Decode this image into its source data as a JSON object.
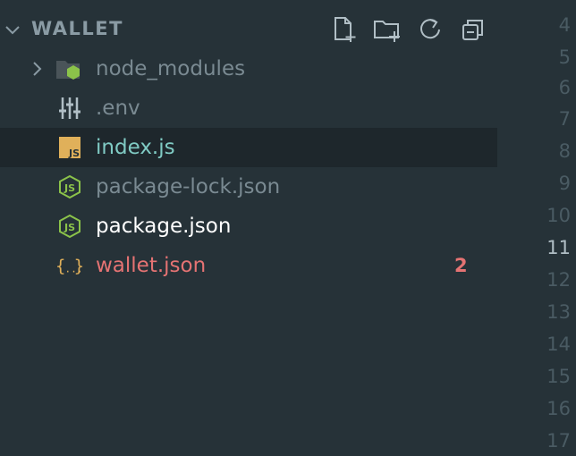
{
  "explorer": {
    "title": "WALLET",
    "actions": [
      {
        "name": "new-file-icon"
      },
      {
        "name": "new-folder-icon"
      },
      {
        "name": "refresh-icon"
      },
      {
        "name": "collapse-all-icon"
      }
    ]
  },
  "files": [
    {
      "label": "node_modules",
      "icon": "node-folder-icon",
      "color": "#7a8a92",
      "badge": "",
      "twisty": true,
      "selected": false
    },
    {
      "label": ".env",
      "icon": "settings-sliders-icon",
      "color": "#7a8a92",
      "badge": "",
      "twisty": false,
      "selected": false
    },
    {
      "label": "index.js",
      "icon": "javascript-icon",
      "color": "#80cbc4",
      "badge": "",
      "twisty": false,
      "selected": true
    },
    {
      "label": "package-lock.json",
      "icon": "nodejs-icon",
      "color": "#7a8a92",
      "badge": "",
      "twisty": false,
      "selected": false
    },
    {
      "label": "package.json",
      "icon": "nodejs-icon",
      "color": "#ffffff",
      "badge": "",
      "twisty": false,
      "selected": false
    },
    {
      "label": "wallet.json",
      "icon": "json-braces-icon",
      "color": "#e57373",
      "badge": "2",
      "twisty": false,
      "selected": false
    }
  ],
  "gutter": {
    "lines": [
      "4",
      "5",
      "6",
      "7",
      "8",
      "9",
      "10",
      "11",
      "12",
      "13",
      "14",
      "15",
      "16",
      "17"
    ],
    "active_line": "11"
  },
  "colors": {
    "background": "#263238",
    "selected_row": "#1e272c",
    "error": "#e57373",
    "js_badge": "#e0b05a"
  }
}
